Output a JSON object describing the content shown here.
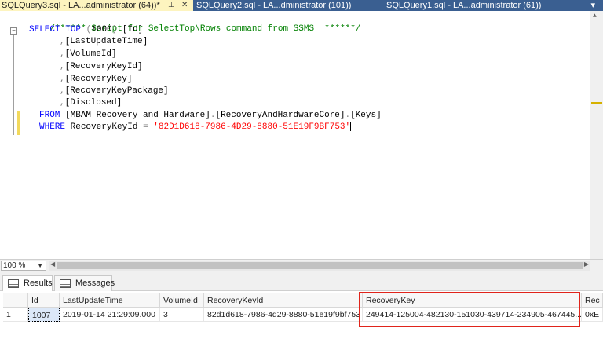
{
  "tabs": [
    {
      "label": "SQLQuery3.sql - LA...administrator (64))*",
      "active": true
    },
    {
      "label": "SQLQuery2.sql - LA...dministrator (101))",
      "active": false
    },
    {
      "label": "SQLQuery1.sql - LA...administrator (61))",
      "active": false
    }
  ],
  "icons": {
    "pin": "pin-icon",
    "close": "close-icon",
    "results": "grid-icon",
    "messages": "messages-icon"
  },
  "editor": {
    "comment": "/****** Script for SelectTopNRows command from SSMS  ******/",
    "select_kw": "SELECT",
    "top_kw": "TOP",
    "top_open": "(",
    "top_value": "1000",
    "top_close": ")",
    "first_col": "[Id]",
    "columns": [
      "[LastUpdateTime]",
      "[VolumeId]",
      "[RecoveryKeyId]",
      "[RecoveryKey]",
      "[RecoveryKeyPackage]",
      "[Disclosed]"
    ],
    "comma": ",",
    "from_kw": "FROM",
    "from_db": "[MBAM Recovery and Hardware]",
    "dot1": ".",
    "from_schema": "[RecoveryAndHardwareCore]",
    "dot2": ".",
    "from_table": "[Keys]",
    "where_kw": "WHERE",
    "where_col": "RecoveryKeyId",
    "where_op": "=",
    "where_value": "'82D1D618-7986-4D29-8880-51E19F9BF753'"
  },
  "zoom": "100 %",
  "results_tabs": {
    "results": "Results",
    "messages": "Messages"
  },
  "grid": {
    "headers": [
      "Id",
      "LastUpdateTime",
      "VolumeId",
      "RecoveryKeyId",
      "RecoveryKey",
      "Rec"
    ],
    "row": {
      "row_number": "1",
      "cells": [
        "1007",
        "2019-01-14 21:29:09.000",
        "3",
        "82d1d618-7986-4d29-8880-51e19f9bf753",
        "249414-125004-482130-151030-439714-234905-467445...",
        "0xE"
      ]
    }
  },
  "colors": {
    "highlight": "#e0241b",
    "active_tab": "#fdf4bf",
    "inactive_tab": "#3a5f91",
    "keyword": "#0000ff",
    "string": "#ff0000",
    "comment": "#008000"
  }
}
